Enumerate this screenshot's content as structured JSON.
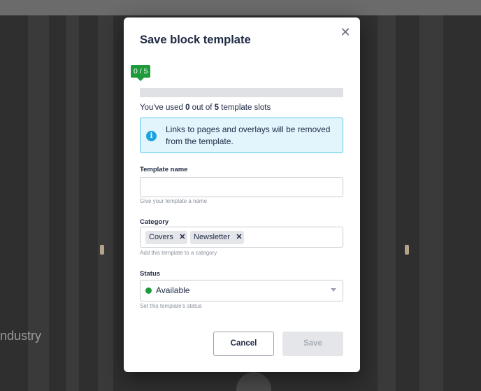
{
  "background": {
    "partial_text": "ndustry"
  },
  "modal": {
    "title": "Save block template",
    "usage": {
      "badge": "0 / 5",
      "used": 0,
      "total": 5,
      "fraction_used": 0,
      "text_prefix": "You've used ",
      "text_used": "0",
      "text_middle": " out of ",
      "text_total": "5",
      "text_suffix": " template slots"
    },
    "info": {
      "icon": "info-icon",
      "message": "Links to pages and overlays will be removed from the template."
    },
    "template_name": {
      "label": "Template name",
      "value": "",
      "helper": "Give your template a name"
    },
    "category": {
      "label": "Category",
      "tags": [
        "Covers",
        "Newsletter"
      ],
      "helper": "Add this template to a category"
    },
    "status": {
      "label": "Status",
      "value": "Available",
      "helper": "Set this template's status"
    },
    "buttons": {
      "cancel": "Cancel",
      "save": "Save"
    }
  },
  "colors": {
    "accent_green": "#1f9a3a",
    "info_blue": "#1aa3e0",
    "info_background": "#e2f5fd"
  }
}
